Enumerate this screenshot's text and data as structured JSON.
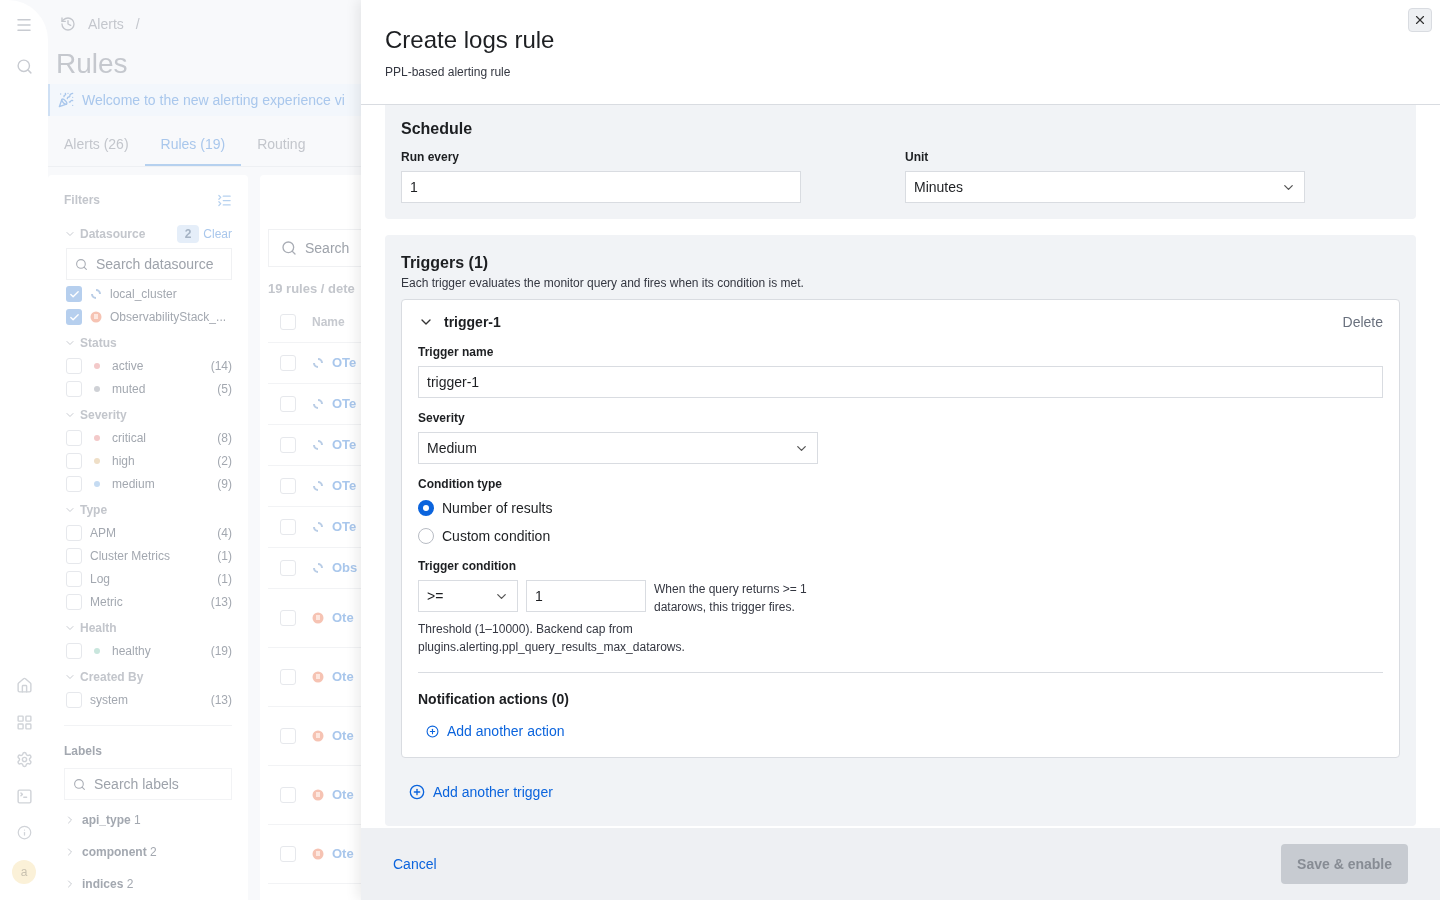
{
  "nav": {
    "avatar": "a"
  },
  "breadcrumbs": [
    {
      "label": "Alerts"
    },
    {
      "label": "/"
    }
  ],
  "page_title": "Rules",
  "callout": "Welcome to the new alerting experience vi",
  "tabs": [
    {
      "label": "Alerts (26)",
      "selected": false
    },
    {
      "label": "Rules (19)",
      "selected": true
    },
    {
      "label": "Routing",
      "selected": false
    }
  ],
  "filters": {
    "title": "Filters",
    "groups": [
      {
        "title": "Datasource",
        "badge": "2",
        "clear": "Clear",
        "search_placeholder": "Search datasource",
        "options": [
          {
            "label": "local_cluster",
            "checked": true,
            "kind": "opensearch"
          },
          {
            "label": "ObservabilityStack_...",
            "checked": true,
            "kind": "prometheus"
          }
        ]
      },
      {
        "title": "Status",
        "options": [
          {
            "label": "active",
            "count": "(14)",
            "checked": false,
            "color": "#f3c9c9"
          },
          {
            "label": "muted",
            "count": "(5)",
            "checked": false,
            "color": "#cfd1d6"
          }
        ]
      },
      {
        "title": "Severity",
        "options": [
          {
            "label": "critical",
            "count": "(8)",
            "checked": false,
            "color": "#f3c9c9"
          },
          {
            "label": "high",
            "count": "(2)",
            "checked": false,
            "color": "#efdfc7"
          },
          {
            "label": "medium",
            "count": "(9)",
            "checked": false,
            "color": "#c5dbf2"
          }
        ]
      },
      {
        "title": "Type",
        "options": [
          {
            "label": "APM",
            "count": "(4)",
            "checked": false
          },
          {
            "label": "Cluster Metrics",
            "count": "(1)",
            "checked": false
          },
          {
            "label": "Log",
            "count": "(1)",
            "checked": false
          },
          {
            "label": "Metric",
            "count": "(13)",
            "checked": false
          }
        ]
      },
      {
        "title": "Health",
        "options": [
          {
            "label": "healthy",
            "count": "(19)",
            "checked": false,
            "color": "#c9e6dd"
          }
        ]
      },
      {
        "title": "Created By",
        "options": [
          {
            "label": "system",
            "count": "(13)",
            "checked": false
          }
        ]
      }
    ]
  },
  "labels": {
    "title": "Labels",
    "search_placeholder": "Search labels",
    "items": [
      {
        "name": "api_type",
        "count": "1"
      },
      {
        "name": "component",
        "count": "2"
      },
      {
        "name": "indices",
        "count": "2"
      }
    ]
  },
  "table": {
    "search_placeholder": "Search",
    "summary": "19 rules / dete",
    "column": "Name",
    "all_checked": false,
    "rows": [
      {
        "name": "OTe",
        "kind": "opensearch",
        "checked": false
      },
      {
        "name": "OTe",
        "kind": "opensearch",
        "checked": false
      },
      {
        "name": "OTe",
        "kind": "opensearch",
        "checked": false
      },
      {
        "name": "OTe",
        "kind": "opensearch",
        "checked": false
      },
      {
        "name": "OTe",
        "kind": "opensearch",
        "checked": false
      },
      {
        "name": "Obs",
        "kind": "opensearch",
        "checked": false
      },
      {
        "name": "Ote",
        "kind": "prometheus",
        "checked": false
      },
      {
        "name": "Ote",
        "kind": "prometheus",
        "checked": false
      },
      {
        "name": "Ote",
        "kind": "prometheus",
        "checked": false
      },
      {
        "name": "Ote",
        "kind": "prometheus",
        "checked": false
      },
      {
        "name": "Ote",
        "kind": "prometheus",
        "checked": false
      }
    ]
  },
  "flyout": {
    "title": "Create logs rule",
    "subtitle": "PPL-based alerting rule",
    "schedule": {
      "title": "Schedule",
      "run_every_label": "Run every",
      "run_every": "1",
      "unit_label": "Unit",
      "unit": "Minutes"
    },
    "triggers": {
      "title": "Triggers (1)",
      "description": "Each trigger evaluates the monitor query and fires when its condition is met.",
      "items": [
        {
          "name": "trigger-1",
          "expanded": true,
          "delete": "Delete",
          "name_label": "Trigger name",
          "name_value": "trigger-1",
          "severity_label": "Severity",
          "severity": "Medium",
          "condition_type_label": "Condition type",
          "condition_types": [
            {
              "label": "Number of results",
              "selected": true
            },
            {
              "label": "Custom condition",
              "selected": false
            }
          ],
          "condition_label": "Trigger condition",
          "operator": ">=",
          "threshold": "1",
          "condition_hint": "When the query returns >= 1 datarows, this trigger fires.",
          "threshold_help": "Threshold (1–10000). Backend cap from plugins.alerting.ppl_query_results_max_datarows.",
          "actions_title": "Notification actions (0)",
          "add_action": "Add another action"
        }
      ],
      "add_trigger": "Add another trigger"
    },
    "footer": {
      "cancel": "Cancel",
      "save": "Save & enable",
      "save_disabled": true
    }
  }
}
